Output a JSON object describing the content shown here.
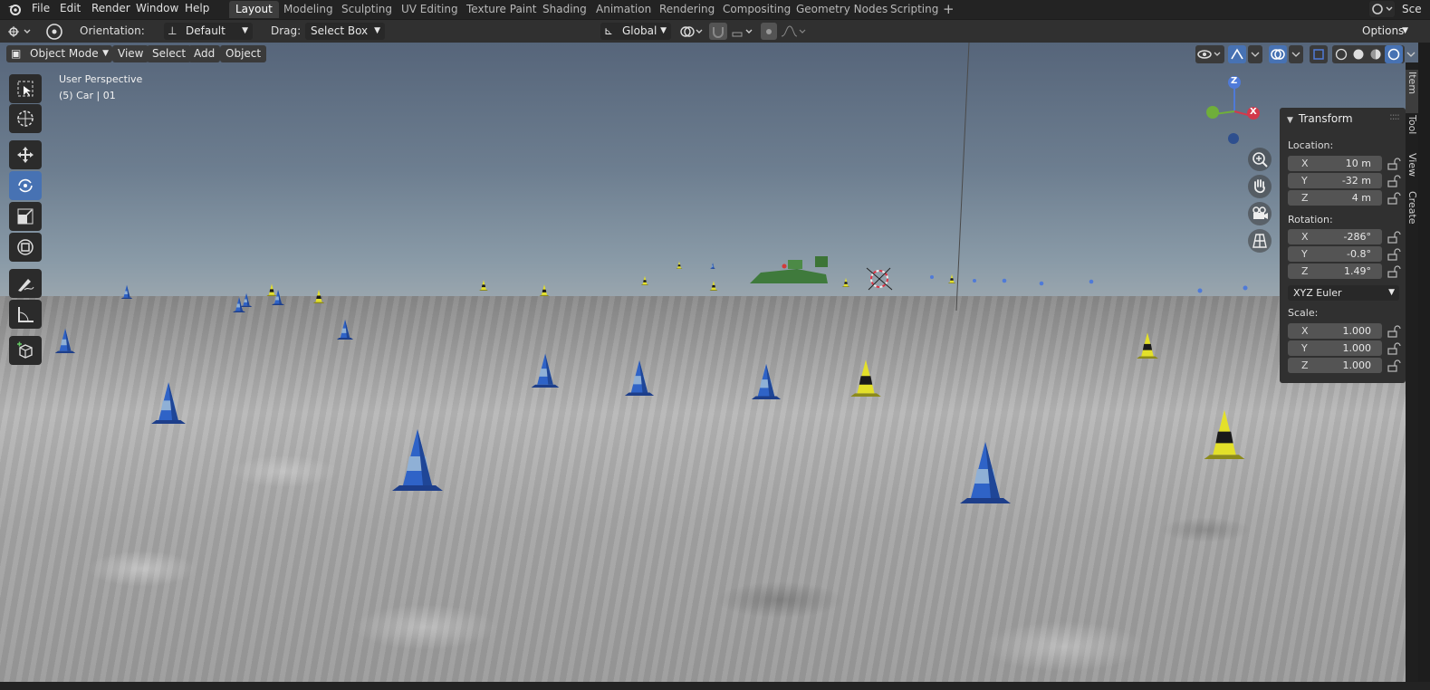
{
  "menus": [
    "File",
    "Edit",
    "Render",
    "Window",
    "Help"
  ],
  "workspace_tabs": [
    "Layout",
    "Modeling",
    "Sculpting",
    "UV Editing",
    "Texture Paint",
    "Shading",
    "Animation",
    "Rendering",
    "Compositing",
    "Geometry Nodes",
    "Scripting"
  ],
  "active_tab": "Layout",
  "scene_label": "Sce",
  "tool_header": {
    "orientation_label": "Orientation:",
    "orientation_value": "Default",
    "drag_label": "Drag:",
    "drag_value": "Select Box",
    "transform_orientation": "Global",
    "options_label": "Options"
  },
  "viewport_header": {
    "mode": "Object Mode",
    "menus": [
      "View",
      "Select",
      "Add",
      "Object"
    ]
  },
  "viewport_info": {
    "perspective": "User Perspective",
    "object": "(5) Car | 01"
  },
  "gizmo": {
    "z": "Z",
    "x": "X"
  },
  "transform_panel": {
    "title": "Transform",
    "location_label": "Location:",
    "location": [
      {
        "axis": "X",
        "value": "10 m"
      },
      {
        "axis": "Y",
        "value": "-32 m"
      },
      {
        "axis": "Z",
        "value": "4 m"
      }
    ],
    "rotation_label": "Rotation:",
    "rotation": [
      {
        "axis": "X",
        "value": "-286°"
      },
      {
        "axis": "Y",
        "value": "-0.8°"
      },
      {
        "axis": "Z",
        "value": "1.49°"
      }
    ],
    "rotation_mode": "XYZ Euler",
    "scale_label": "Scale:",
    "scale": [
      {
        "axis": "X",
        "value": "1.000"
      },
      {
        "axis": "Y",
        "value": "1.000"
      },
      {
        "axis": "Z",
        "value": "1.000"
      }
    ]
  },
  "side_tabs": [
    "Item",
    "Tool",
    "View",
    "Create"
  ],
  "colors": {
    "accent": "#4772b3",
    "cone_blue": "#2d5fbf",
    "cone_yellow": "#e3e02a",
    "car_green": "#3f7a3c"
  }
}
